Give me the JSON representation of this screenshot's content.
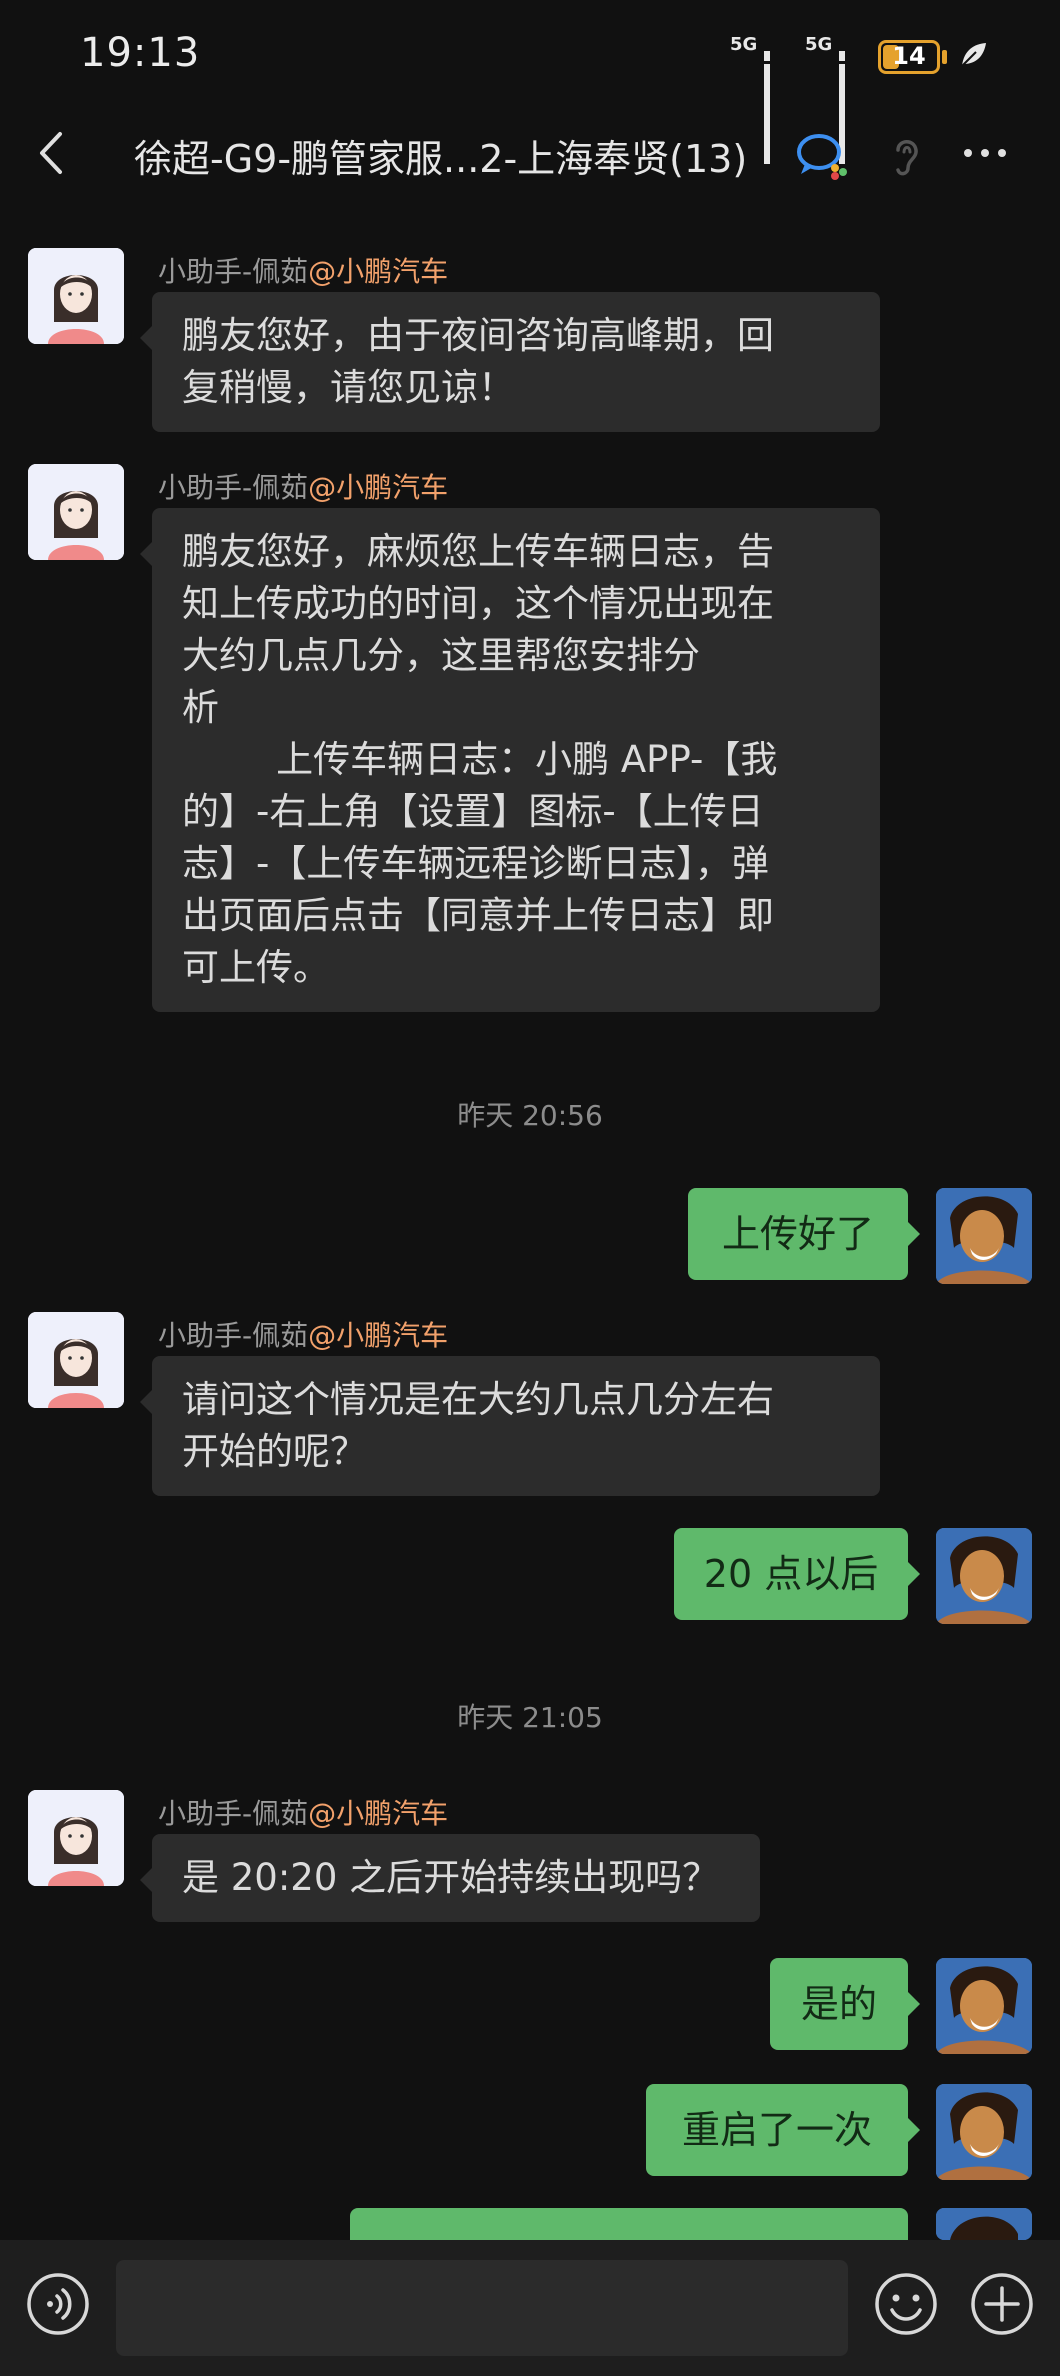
{
  "status_bar": {
    "time": "19:13",
    "network_1": "5G",
    "network_2": "5G",
    "battery": "14"
  },
  "header": {
    "title": "徐超-G9-鹏管家服...2-上海奉贤(13)"
  },
  "messages": {
    "m1": {
      "sender_name": "小助手-佩茹",
      "sender_org": "@小鹏汽车",
      "text": "鹏友您好，由于夜间咨询高峰期，回\n复稍慢，请您见谅！"
    },
    "m2": {
      "sender_name": "小助手-佩茹",
      "sender_org": "@小鹏汽车",
      "text": "鹏友您好，麻烦您上传车辆日志，告\n知上传成功的时间，这个情况出现在\n大约几点几分，这里帮您安排分\n析\n        上传车辆日志：小鹏 APP-【我\n的】-右上角【设置】图标-【上传日\n志】-【上传车辆远程诊断日志】，弹\n出页面后点击【同意并上传日志】即\n可上传。"
    },
    "ts1": "昨天 20:56",
    "m3": {
      "text": "上传好了"
    },
    "m4": {
      "sender_name": "小助手-佩茹",
      "sender_org": "@小鹏汽车",
      "text": "请问这个情况是在大约几点几分左右\n开始的呢？"
    },
    "m5": {
      "text": "20 点以后"
    },
    "ts2": "昨天 21:05",
    "m6": {
      "sender_name": "小助手-佩茹",
      "sender_org": "@小鹏汽车",
      "text": "是 20:20 之后开始持续出现吗？"
    },
    "m7": {
      "text": "是的"
    },
    "m8": {
      "text": "重启了一次"
    }
  },
  "input": {
    "value": ""
  },
  "icons": {
    "back": "chevron-left-icon",
    "group_chat": "chat-bubbles-icon",
    "ear": "ear-icon",
    "more": "more-dots-icon",
    "voice": "voice-icon",
    "emoji": "emoji-icon",
    "plus": "plus-icon"
  },
  "colors": {
    "background": "#111111",
    "bubble_in": "#2c2c2c",
    "bubble_out": "#5fb96b",
    "org_accent": "#f2a16b",
    "battery": "#e5a22d"
  }
}
